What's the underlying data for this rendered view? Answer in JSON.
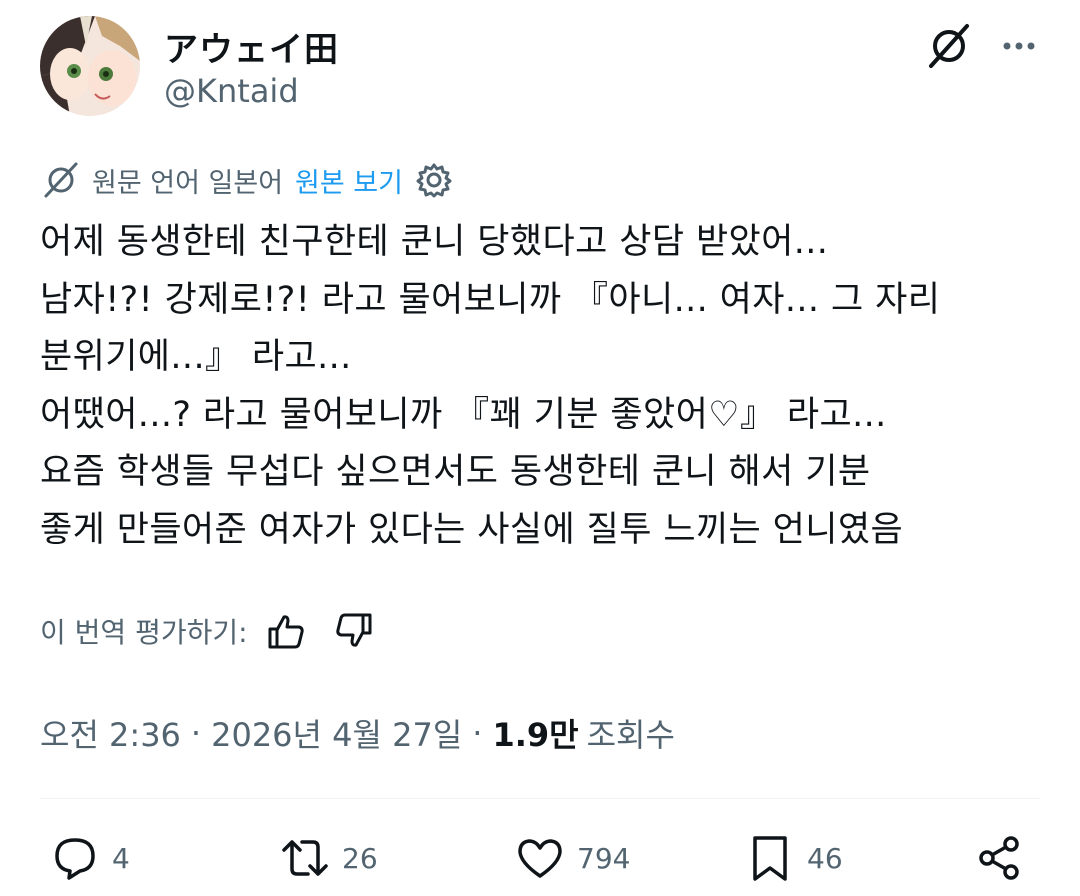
{
  "author": {
    "display_name": "アウェイ田",
    "handle": "@Kntaid"
  },
  "translation_bar": {
    "source_language_text": "원문 언어 일본어",
    "show_original_label": "원본 보기"
  },
  "tweet": {
    "lines": [
      "어제 동생한테 친구한테 쿤니 당했다고 상담 받았어...",
      "남자!?! 강제로!?! 라고 물어보니까 『아니... 여자... 그 자리",
      "분위기에...』 라고...",
      "어땠어...? 라고 물어보니까 『꽤 기분 좋았어♡』 라고...",
      "요즘 학생들 무섭다 싶으면서도 동생한테 쿤니 해서 기분",
      "좋게 만들어준 여자가 있다는 사실에 질투 느끼는 언니였음"
    ]
  },
  "rate_translation": {
    "label": "이 번역 평가하기:"
  },
  "meta": {
    "time": "오전 2:36",
    "date": "2026년 4월 27일",
    "separator": "·",
    "views_count": "1.9만",
    "views_label": "조회수"
  },
  "actions": {
    "replies": "4",
    "reposts": "26",
    "likes": "794",
    "bookmarks": "46"
  },
  "colors": {
    "text": "#0f1419",
    "secondary": "#536471",
    "link": "#1d9bf0",
    "divider": "#eff3f4"
  },
  "icons": {
    "grok": "grok-icon",
    "more": "more-icon",
    "translate": "translate-icon",
    "settings": "settings-icon",
    "thumbs_up": "thumbs-up-icon",
    "thumbs_down": "thumbs-down-icon",
    "reply": "reply-icon",
    "repost": "repost-icon",
    "like": "like-icon",
    "bookmark": "bookmark-icon",
    "share": "share-icon"
  }
}
